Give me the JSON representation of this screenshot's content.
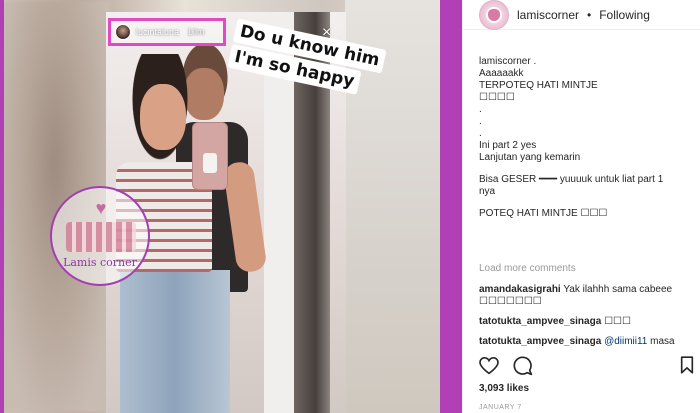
{
  "post": {
    "header": {
      "username": "lamiscorner",
      "separator": "•",
      "follow_status": "Following"
    },
    "caption_lines": [
      "lamiscorner .",
      "Aaaaaakk",
      "TERPOTEQ HATI MINTJE",
      "☐☐☐☐",
      ".",
      ".",
      ".",
      "Ini part 2 yes",
      "Lanjutan yang kemarin"
    ],
    "caption_lines_2": [
      "Bisa GESER ━━━ yuuuuk untuk liat part 1",
      "nya"
    ],
    "caption_line_3": "POTEQ HATI MINTJE ☐☐☐",
    "load_more": "Load more comments",
    "comments": [
      {
        "user": "amandakasigrahi",
        "text": "Yak ilahhh sama cabeee",
        "text2": "☐☐☐☐☐☐☐"
      },
      {
        "user": "tatotukta_ampvee_sinaga",
        "text": "☐☐☐"
      },
      {
        "user": "tatotukta_ampvee_sinaga",
        "mention": "@diimii11",
        "text": "masa"
      }
    ],
    "likes": "3,093 likes",
    "date": "JANUARY 7"
  },
  "story": {
    "username": "lucintaluna",
    "time": "10m",
    "close_symbol": "×",
    "sticker_lines": [
      "Do u know him",
      "I'm so happy"
    ]
  },
  "watermark": {
    "text": "Lamis corner",
    "heart": "♥"
  },
  "icons": {
    "heart": "heart-icon",
    "comment": "comment-icon",
    "bookmark": "bookmark-icon"
  },
  "colors": {
    "accent_border": "#b13fb5",
    "highlight_box": "#e04bc4"
  }
}
